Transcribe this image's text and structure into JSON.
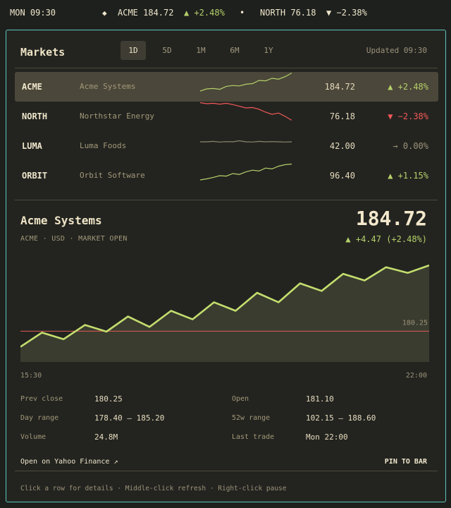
{
  "topbar": {
    "clock": "MON 09:30",
    "diamond": "◆",
    "ticker1": "ACME 184.72",
    "change1": "▲ +2.48%",
    "dot": "•",
    "ticker2": "NORTH 76.18",
    "change2": "▼ −2.38%"
  },
  "header": {
    "title": "Markets",
    "tabs": [
      "1D",
      "5D",
      "1M",
      "6M",
      "1Y"
    ],
    "active_tab": "1D",
    "updated": "Updated 09:30"
  },
  "rows": [
    {
      "symbol": "ACME",
      "name": "Acme Systems",
      "price": "184.72",
      "change": "▲ +2.48%",
      "trend": "up",
      "spark": [
        0.1,
        0.2,
        0.22,
        0.18,
        0.32,
        0.36,
        0.34,
        0.42,
        0.45,
        0.6,
        0.58,
        0.7,
        0.66,
        0.78,
        0.95
      ]
    },
    {
      "symbol": "NORTH",
      "name": "Northstar Energy",
      "price": "76.18",
      "change": "▼ −2.38%",
      "trend": "down",
      "spark": [
        0.95,
        0.9,
        0.92,
        0.88,
        0.92,
        0.86,
        0.78,
        0.7,
        0.72,
        0.64,
        0.5,
        0.4,
        0.46,
        0.3,
        0.12
      ]
    },
    {
      "symbol": "LUMA",
      "name": "Luma Foods",
      "price": "42.00",
      "change": "→ 0.00%",
      "trend": "flat",
      "spark": [
        0.5,
        0.5,
        0.52,
        0.49,
        0.51,
        0.5,
        0.55,
        0.5,
        0.49,
        0.52,
        0.5,
        0.51,
        0.5,
        0.49,
        0.5
      ]
    },
    {
      "symbol": "ORBIT",
      "name": "Orbit Software",
      "price": "96.40",
      "change": "▲ +1.15%",
      "trend": "up",
      "spark": [
        0.1,
        0.15,
        0.22,
        0.3,
        0.28,
        0.4,
        0.36,
        0.48,
        0.56,
        0.52,
        0.66,
        0.62,
        0.75,
        0.82,
        0.85
      ]
    }
  ],
  "detail": {
    "name": "Acme Systems",
    "subtitle": "ACME · USD · MARKET OPEN",
    "price": "184.72",
    "change": "▲ +4.47  (+2.48%)",
    "stats": [
      {
        "label": "Prev close",
        "value": "180.25"
      },
      {
        "label": "Open",
        "value": "181.10"
      },
      {
        "label": "Day range",
        "value": "178.40 – 185.20"
      },
      {
        "label": "52w range",
        "value": "102.15 – 188.60"
      },
      {
        "label": "Volume",
        "value": "24.8M"
      },
      {
        "label": "Last trade",
        "value": "Mon 22:00"
      }
    ]
  },
  "footer": {
    "link": "Open on Yahoo Finance ↗",
    "pin": "PIN TO BAR",
    "hint": "Click a row for details · Middle-click refresh · Right-click pause"
  },
  "colors": {
    "up": "#b5d06a",
    "down": "#f35858",
    "flat": "#8e866f",
    "accent": "#5cc6bd"
  },
  "chart_data": {
    "type": "area",
    "series": [
      {
        "values": [
          178.6,
          180.1,
          179.4,
          180.9,
          180.2,
          181.8,
          180.7,
          182.4,
          181.5,
          183.3,
          182.4,
          184.3,
          183.3,
          185.3,
          184.5,
          186.3,
          185.6,
          187.0,
          186.4,
          187.2
        ]
      }
    ],
    "x": [
      "15:30",
      "",
      "",
      "",
      "",
      "",
      "",
      "",
      "",
      "",
      "",
      "",
      "",
      "",
      "",
      "",
      "",
      "",
      "",
      "22:00"
    ],
    "xtick_labels": [
      "15:30",
      "22:00"
    ],
    "reference_line": {
      "value": 180.25,
      "label": "180.25",
      "color": "#e05b55"
    },
    "ylim": [
      177.0,
      187.8
    ],
    "grid": false,
    "line_color": "#c4de6e",
    "fill_color": "#3a3c2f"
  }
}
